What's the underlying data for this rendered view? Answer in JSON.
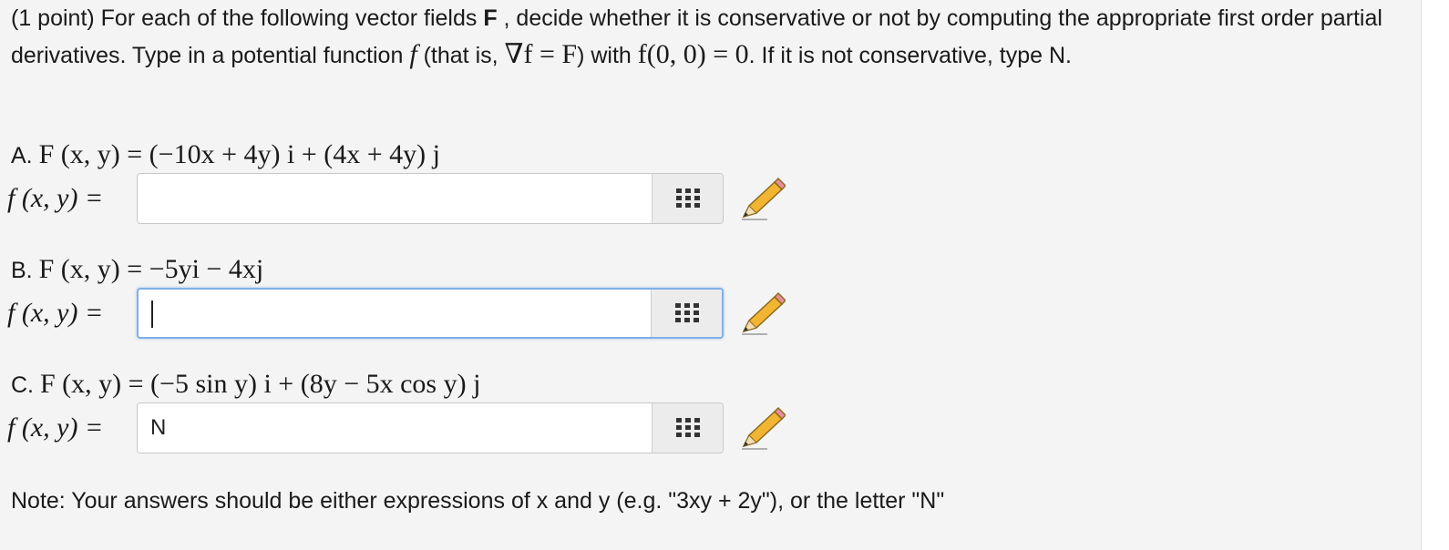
{
  "intro": {
    "part1": "(1 point) For each of the following vector fields ",
    "bold_F": "F",
    "part2": " , decide whether it is conservative or not by computing the appropriate first order partial derivatives. Type in a potential function ",
    "f_sym": "f",
    "part3": " (that is, ",
    "grad_expr": "∇f = F",
    "part4": ") with ",
    "cond_expr": "f(0, 0) = 0",
    "part5": ". If it is not conservative, type N."
  },
  "problems": [
    {
      "letter": "A.",
      "field_lhs": "F (x, y) = ",
      "field_rhs": "(−10x + 4y) i + (4x + 4y) j",
      "f_label": "f (x, y) =",
      "answer_value": "",
      "focused": false
    },
    {
      "letter": "B.",
      "field_lhs": "F (x, y) = ",
      "field_rhs": "−5yi − 4xj",
      "f_label": "f (x, y) =",
      "answer_value": "",
      "focused": true
    },
    {
      "letter": "C.",
      "field_lhs": "F (x, y) = ",
      "field_rhs": "(−5 sin y) i + (8y − 5x cos y) j",
      "f_label": "f (x, y) =",
      "answer_value": "N",
      "focused": false
    }
  ],
  "note": "Note: Your answers should be either expressions of x and y (e.g. \"3xy + 2y\"), or the letter \"N\"",
  "icons": {
    "equation_editor": "grid-icon",
    "preview": "pencil-icon"
  },
  "colors": {
    "panel_bg": "#f4f4f4",
    "focus_border": "#7fb0e8"
  }
}
